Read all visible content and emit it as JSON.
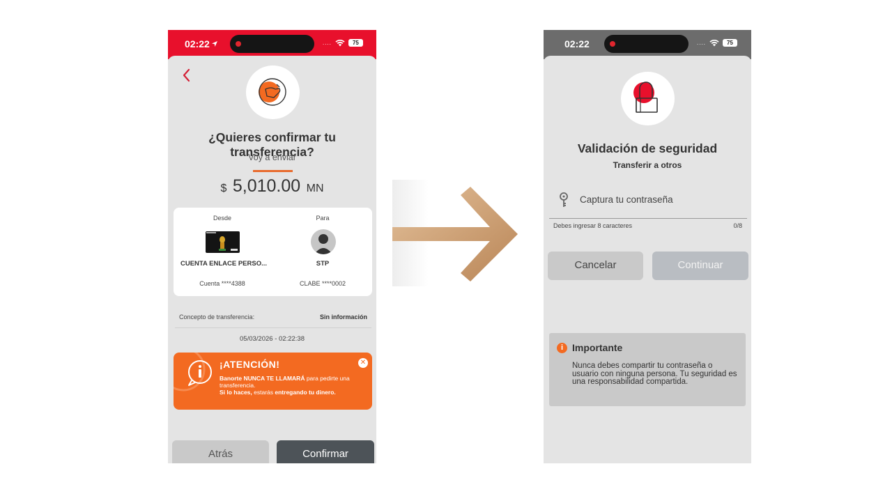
{
  "screen1": {
    "status_time": "02:22",
    "battery": "75",
    "title": "¿Quieres confirmar tu transferencia?",
    "send_label": "Voy a enviar",
    "amount": {
      "currency": "$",
      "value": "5,010.00",
      "unit": "MN"
    },
    "from": {
      "label": "Desde",
      "name": "CUENTA ENLACE PERSO...",
      "account": "Cuenta ****4388"
    },
    "to": {
      "label": "Para",
      "name": "STP",
      "account": "CLABE ****0002"
    },
    "concept_label": "Concepto de transferencia:",
    "concept_value": "Sin información",
    "datetime": "05/03/2026 - 02:22:38",
    "alert": {
      "title": "¡ATENCIÓN!",
      "line1_bold": "Banorte NUNCA TE LLAMARÁ",
      "line1_rest": " para pedirte una transferencia.",
      "line2_bold1": "Si lo haces,",
      "line2_mid": " estarás ",
      "line2_bold2": "entregando tu dinero."
    },
    "back_label": "Atrás",
    "confirm_label": "Confirmar"
  },
  "screen2": {
    "status_time": "02:22",
    "battery": "75",
    "title": "Validación de seguridad",
    "subtitle": "Transferir a otros",
    "password_placeholder": "Captura tu contraseña",
    "hint": "Debes ingresar 8 caracteres",
    "counter": "0/8",
    "cancel_label": "Cancelar",
    "continue_label": "Continuar",
    "important_title": "Importante",
    "important_body": "Nunca debes compartir tu contraseña o usuario con ninguna persona. Tu seguridad es una responsabilidad compartida."
  },
  "icons": [
    "location-arrow-icon",
    "wifi-icon",
    "battery-icon",
    "back-chevron-icon",
    "transfer-hand-icon",
    "world-cup-card-icon",
    "user-avatar-icon",
    "info-icon",
    "close-icon",
    "security-lock-icon",
    "key-icon",
    "warning-info-icon",
    "right-arrow-icon"
  ],
  "colors": {
    "brand_red": "#e8102c",
    "orange": "#f36a21",
    "dark_button": "#4d5358",
    "arrow": "#c89a6a"
  }
}
